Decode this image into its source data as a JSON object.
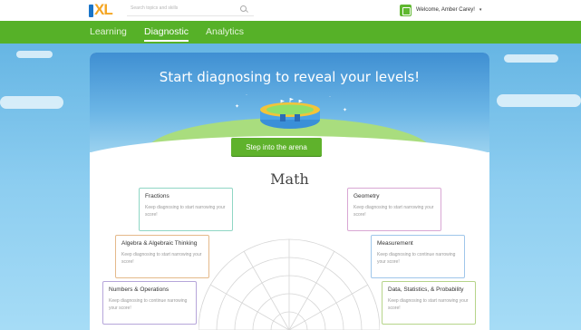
{
  "header": {
    "logo": {
      "text": "XL",
      "icon": "ixl-logo"
    },
    "search": {
      "placeholder": "Search topics and skills",
      "icon": "search-icon"
    },
    "user": {
      "name": "Welcome, Amber Carey!",
      "caret": "▾"
    }
  },
  "nav": {
    "items": [
      {
        "label": "Learning",
        "active": false
      },
      {
        "label": "Diagnostic",
        "active": true
      },
      {
        "label": "Analytics",
        "active": false
      }
    ]
  },
  "hero": {
    "title": "Start diagnosing to reveal your levels!",
    "button": "Step into the arena"
  },
  "subject": "Math",
  "skills": [
    {
      "name": "Fractions",
      "desc": "Keep diagnosing to start narrowing your score!",
      "color": "#8fd6c4"
    },
    {
      "name": "Geometry",
      "desc": "Keep diagnosing to start narrowing your score!",
      "color": "#d9a7d4"
    },
    {
      "name": "Algebra & Algebraic Thinking",
      "desc": "Keep diagnosing to start narrowing your score!",
      "color": "#e4b98a"
    },
    {
      "name": "Measurement",
      "desc": "Keep diagnosing to continue narrowing your score!",
      "color": "#9fc6ea"
    },
    {
      "name": "Numbers & Operations",
      "desc": "Keep diagnosing to continue narrowing your score!",
      "color": "#b6a6da"
    },
    {
      "name": "Data, Statistics, & Probability",
      "desc": "Keep diagnosing to start narrowing your score!",
      "color": "#b6d48a"
    }
  ],
  "colors": {
    "nav_green": "#56b128",
    "button_green": "#5fb22c",
    "sky": "#5aaee0"
  }
}
